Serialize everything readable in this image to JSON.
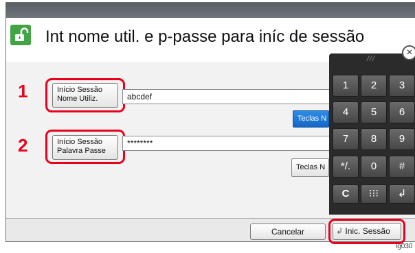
{
  "header": {
    "title": "Int nome util. e p-passe para iníc de sessão",
    "icon": "unlocked-padlock-icon"
  },
  "callouts": [
    "1",
    "2"
  ],
  "fields": [
    {
      "label_line1": "Início Sessão",
      "label_line2": "Nome Utiliz.",
      "value": "abcdef",
      "keyboard_label": "Teclas N"
    },
    {
      "label_line1": "Início Sessão",
      "label_line2": "Palavra Passe",
      "value": "********",
      "keyboard_label": "Teclas N"
    }
  ],
  "keypad": {
    "grip": "///",
    "keys": [
      [
        "1",
        "2",
        "3"
      ],
      [
        "4",
        "5",
        "6"
      ],
      [
        "7",
        "8",
        "9"
      ],
      [
        "*/.",
        "0",
        "#"
      ],
      [
        "C",
        "⁝⁝⁝",
        "↲"
      ]
    ]
  },
  "footer": {
    "cancel_label": "Cancelar",
    "login_label": "Inic. Sessão",
    "image_id": "lg030"
  },
  "colors": {
    "accent_red": "#e8001c",
    "lock_green": "#41a445",
    "keyboard_blue": "#1a6fd1"
  }
}
